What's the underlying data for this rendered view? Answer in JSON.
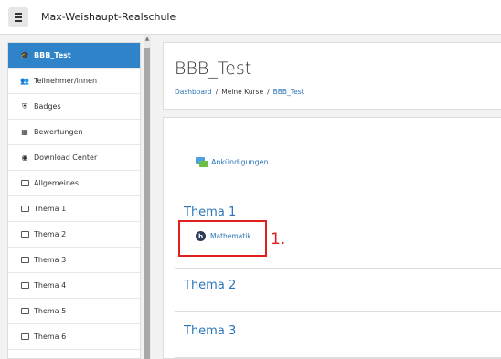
{
  "topbar": {
    "menu_icon": "hamburger-icon",
    "site_name": "Max-Weishaupt-Realschule"
  },
  "sidebar": {
    "items": [
      {
        "label": "BBB_Test",
        "icon": "graduation-cap-icon",
        "active": true
      },
      {
        "label": "Teilnehmer/innen",
        "icon": "users-icon",
        "active": false
      },
      {
        "label": "Badges",
        "icon": "shield-icon",
        "active": false
      },
      {
        "label": "Bewertungen",
        "icon": "table-icon",
        "active": false
      },
      {
        "label": "Download Center",
        "icon": "download-icon",
        "active": false
      },
      {
        "label": "Allgemeines",
        "icon": "folder-icon",
        "active": false
      },
      {
        "label": "Thema 1",
        "icon": "folder-icon",
        "active": false
      },
      {
        "label": "Thema 2",
        "icon": "folder-icon",
        "active": false
      },
      {
        "label": "Thema 3",
        "icon": "folder-icon",
        "active": false
      },
      {
        "label": "Thema 4",
        "icon": "folder-icon",
        "active": false
      },
      {
        "label": "Thema 5",
        "icon": "folder-icon",
        "active": false
      },
      {
        "label": "Thema 6",
        "icon": "folder-icon",
        "active": false
      }
    ]
  },
  "header": {
    "title": "BBB_Test",
    "breadcrumb": [
      "Dashboard",
      "Meine Kurse",
      "BBB_Test"
    ]
  },
  "content": {
    "announcements": "Ankündigungen",
    "sections": [
      {
        "title": "Thema 1",
        "activity": "Mathematik"
      },
      {
        "title": "Thema 2"
      },
      {
        "title": "Thema 3"
      }
    ]
  },
  "annotation": {
    "step_label": "1.",
    "color": "#e0201c"
  },
  "colors": {
    "accent": "#2f84c9",
    "link": "#2a74b8"
  }
}
